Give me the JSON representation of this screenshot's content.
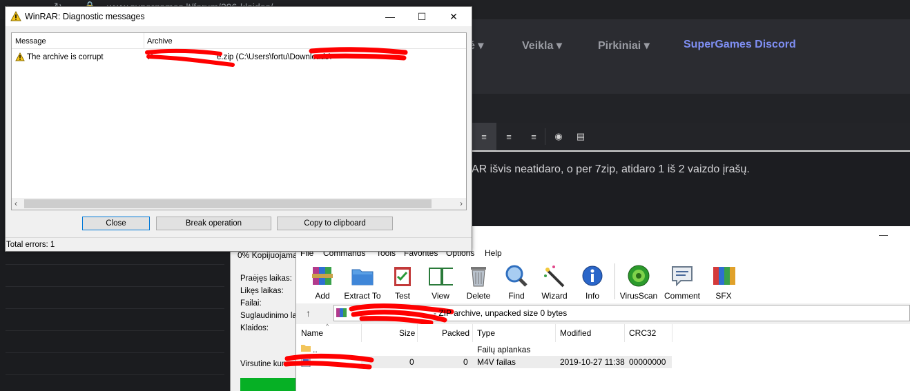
{
  "browser": {
    "url": "www.supergames.lt/forum/296-klaidos/"
  },
  "site": {
    "nav": [
      {
        "label": "é",
        "arrow": "▾"
      },
      {
        "label": "Veikla",
        "arrow": "▾"
      },
      {
        "label": "Pirkiniai",
        "arrow": "▾"
      },
      {
        "label": "SuperGames Discord",
        "arrow": ""
      }
    ],
    "accent": "#7f8ff4",
    "post_text": "AR išvis neatidaro, o per 7zip, atidaro 1 iš 2 vaizdo įrašų."
  },
  "progress": {
    "title": "0% Kopijuojama",
    "labels": [
      "Praėjęs laikas:",
      "Likęs laikas:",
      "Failai:",
      "Suglaudinimo laip",
      "Klaidos:"
    ],
    "bottom_label": "Virsutine kuno",
    "bar_color": "#06b025"
  },
  "winrar": {
    "minimize": "—",
    "menu": [
      "File",
      "Commands",
      "Tools",
      "Favorites",
      "Options",
      "Help"
    ],
    "toolbar": [
      {
        "label": "Add",
        "icon": "add-archive-icon"
      },
      {
        "label": "Extract To",
        "icon": "extract-folder-icon"
      },
      {
        "label": "Test",
        "icon": "test-clipboard-icon"
      },
      {
        "label": "View",
        "icon": "view-book-icon"
      },
      {
        "label": "Delete",
        "icon": "trash-icon"
      },
      {
        "label": "Find",
        "icon": "magnifier-icon"
      },
      {
        "label": "Wizard",
        "icon": "wand-icon"
      },
      {
        "label": "Info",
        "icon": "info-icon"
      },
      {
        "label": "VirusScan",
        "icon": "virus-scan-icon"
      },
      {
        "label": "Comment",
        "icon": "comment-icon"
      },
      {
        "label": "SFX",
        "icon": "sfx-books-icon"
      }
    ],
    "path_text": "- ZIP archive, unpacked size 0 bytes",
    "columns": [
      "Name",
      "Size",
      "Packed",
      "Type",
      "Modified",
      "CRC32"
    ],
    "rows": [
      {
        "name": "..",
        "size": "",
        "packed": "",
        "type": "Failų aplankas",
        "modified": "",
        "crc": ""
      },
      {
        "name": "",
        "size": "0",
        "packed": "0",
        "type": "M4V failas",
        "modified": "2019-10-27 11:38",
        "crc": "00000000"
      }
    ]
  },
  "diag": {
    "title": "WinRAR: Diagnostic messages",
    "columns": [
      "Message",
      "Archive"
    ],
    "message": "The archive is corrupt",
    "archive_prefix": "P",
    "archive_visible": "e.zip (C:\\Users\\fortu\\Downloads\\",
    "buttons": {
      "close": "Close",
      "break": "Break operation",
      "copy": "Copy to clipboard"
    },
    "status": "Total errors: 1",
    "redact_color": "#ff0000"
  }
}
